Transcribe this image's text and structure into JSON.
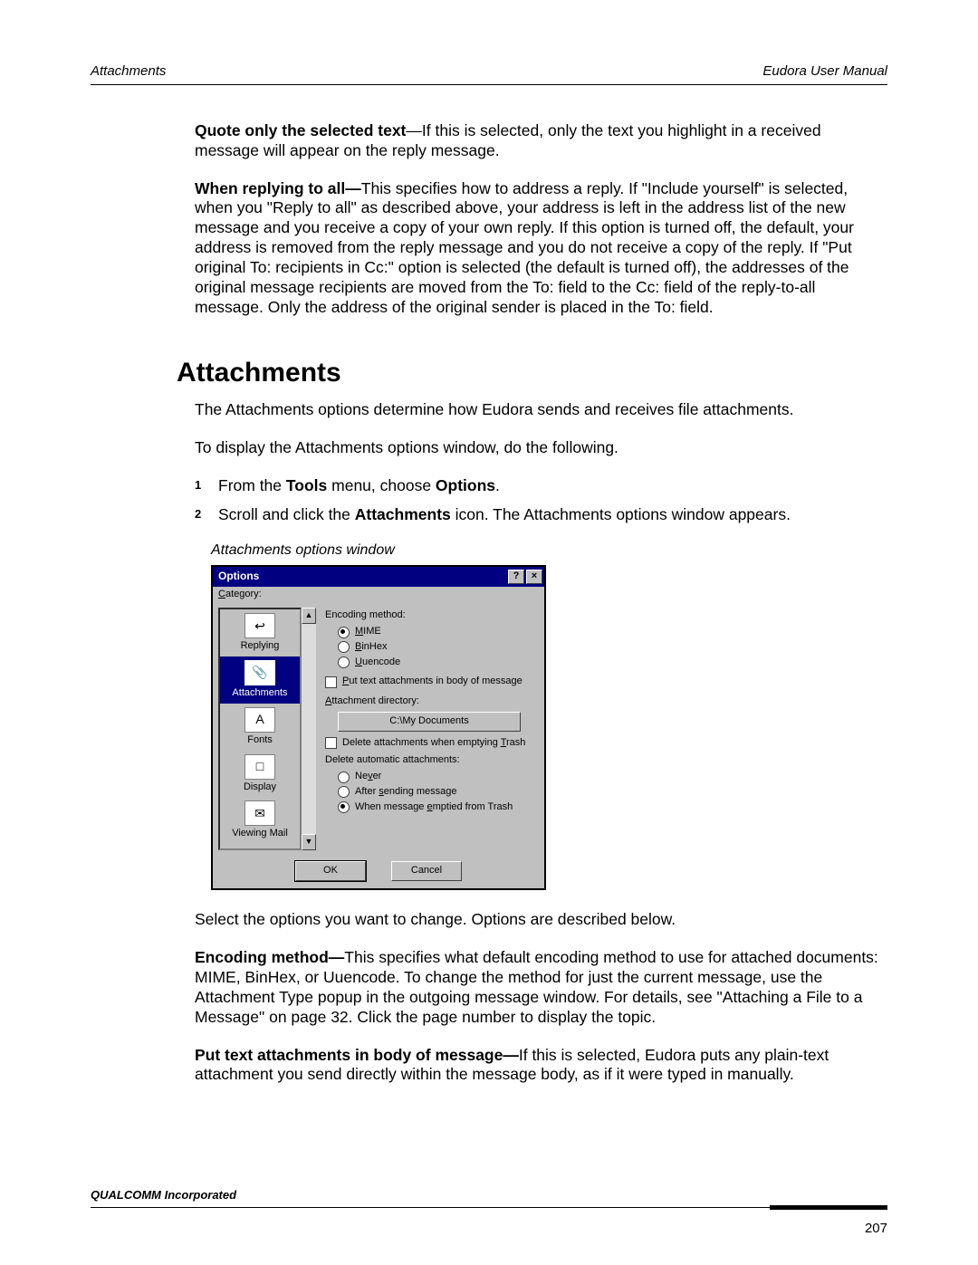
{
  "header": {
    "left": "Attachments",
    "right": "Eudora User Manual"
  },
  "intro": {
    "quote_bold": "Quote only the selected text",
    "quote_rest": "—If this is selected, only the text you highlight in a received message will appear on the reply message.",
    "reply_bold": "When replying to all—",
    "reply_rest": "This specifies how to address a reply. If \"Include yourself\" is selected, when you \"Reply to all\" as described above, your address is left in the address list of the new message and you receive a copy of your own reply. If this option is turned off, the default, your address is removed from the reply message and you do not receive a copy of the reply. If \"Put original To: recipients in Cc:\" option is selected (the default is turned off), the addresses of the original message recipients are moved from the To: field to the Cc: field of the reply-to-all message. Only the address of the original sender is placed in the To: field."
  },
  "section_title": "Attachments",
  "section": {
    "p1": "The Attachments options determine how Eudora sends and receives file attachments.",
    "p2": "To display the Attachments options window, do the following.",
    "steps": [
      {
        "n": "1",
        "pre": "From the ",
        "b1": "Tools",
        "mid": " menu, choose ",
        "b2": "Options",
        "post": "."
      },
      {
        "n": "2",
        "pre": "Scroll and click the ",
        "b1": "Attachments",
        "mid": " icon. The Attachments options window appears.",
        "b2": "",
        "post": ""
      }
    ],
    "caption": "Attachments options window"
  },
  "dialog": {
    "title": "Options",
    "help_label": "?",
    "close_label": "×",
    "category_label_pre": "C",
    "category_label_post": "ategory:",
    "scroll_up": "▲",
    "scroll_down": "▼",
    "categories": [
      {
        "label": "Replying",
        "selected": false,
        "icon": "↩"
      },
      {
        "label": "Attachments",
        "selected": true,
        "icon": "📎"
      },
      {
        "label": "Fonts",
        "selected": false,
        "icon": "A"
      },
      {
        "label": "Display",
        "selected": false,
        "icon": "□"
      },
      {
        "label": "Viewing Mail",
        "selected": false,
        "icon": "✉"
      }
    ],
    "encoding_label": "Encoding method:",
    "encoding": [
      {
        "label_u": "M",
        "label_rest": "IME",
        "checked": true
      },
      {
        "label_u": "B",
        "label_rest": "inHex",
        "checked": false
      },
      {
        "label_u": "U",
        "label_rest": "uencode",
        "checked": false
      }
    ],
    "put_text_u": "P",
    "put_text_rest": "ut text attachments in body of message",
    "attach_dir_label_u": "A",
    "attach_dir_label_rest": "ttachment directory:",
    "attach_dir_value": "C:\\My Documents",
    "delete_chk_pre": "Delete attachments when emptying ",
    "delete_chk_u": "T",
    "delete_chk_post": "rash",
    "delete_auto_label": "Delete automatic attachments:",
    "delete_auto": [
      {
        "pre": "Ne",
        "u": "v",
        "post": "er",
        "checked": false
      },
      {
        "pre": "After ",
        "u": "s",
        "post": "ending message",
        "checked": false
      },
      {
        "pre": "When message ",
        "u": "e",
        "post": "mptied from Trash",
        "checked": true
      }
    ],
    "ok": "OK",
    "cancel": "Cancel"
  },
  "after": {
    "p1": "Select the options you want to change. Options are described below.",
    "enc_bold": "Encoding method—",
    "enc_rest": "This specifies what default encoding method to use for attached documents: MIME, BinHex, or Uuencode. To change the method for just the current message, use the Attachment Type popup in the outgoing message window. For details, see \"Attaching a File to a Message\" on page 32. Click the page number to display the topic.",
    "put_bold": "Put text attachments in body of message—",
    "put_rest": "If this is selected, Eudora puts any plain-text attachment you send directly within the message body, as if it were typed in manually."
  },
  "footer": {
    "company": "QUALCOMM Incorporated",
    "page": "207"
  }
}
